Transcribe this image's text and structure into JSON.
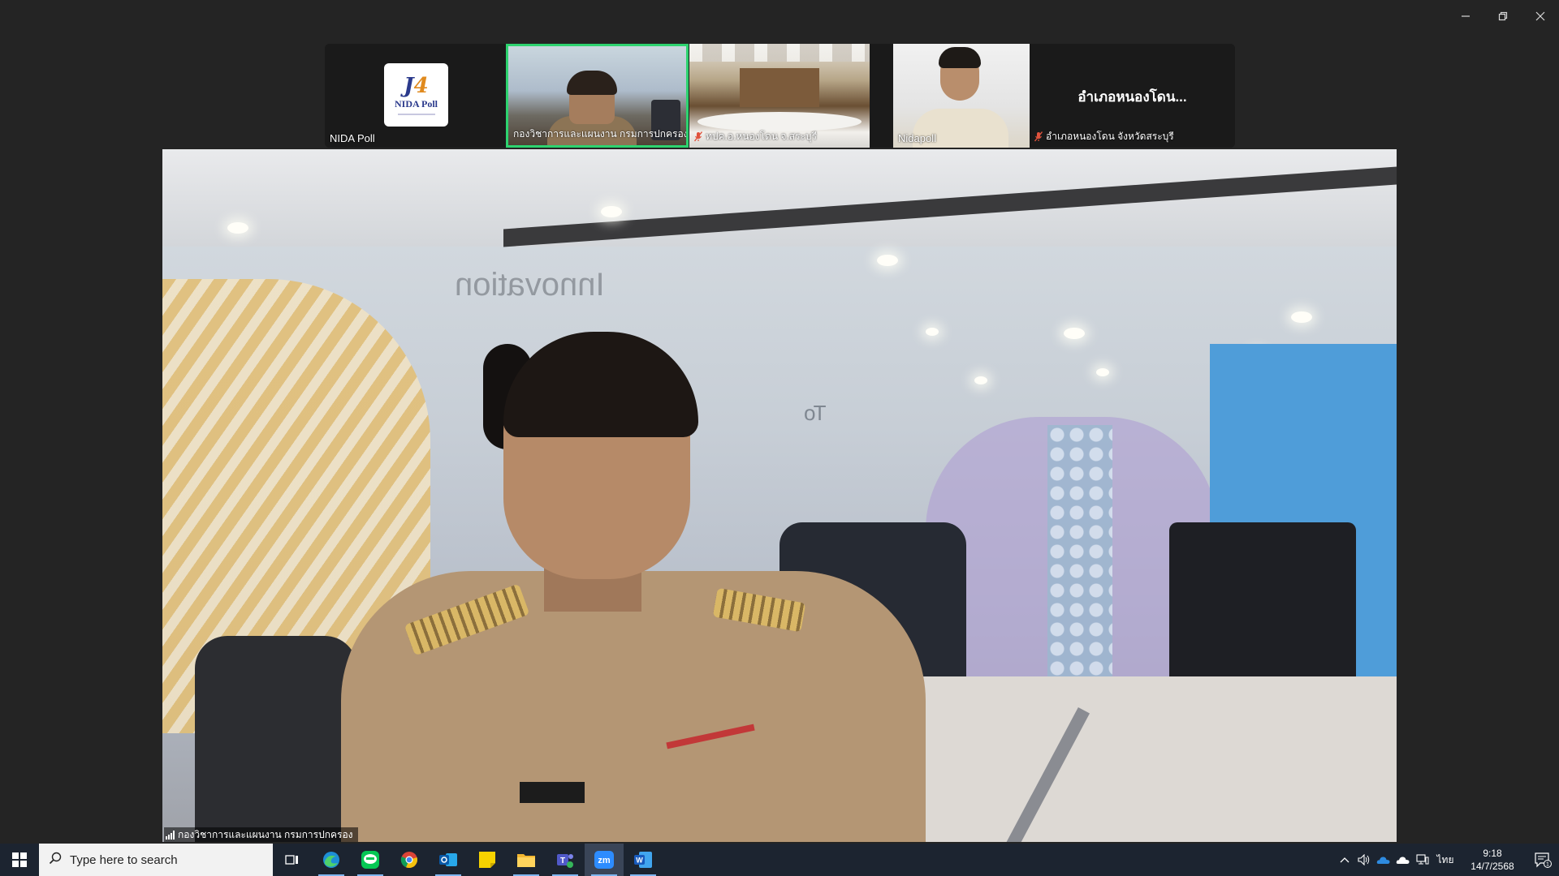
{
  "window": {
    "controls": [
      "minimize-icon",
      "restore-icon",
      "close-icon"
    ]
  },
  "participants": {
    "nida_poll": {
      "name": "NIDA Poll",
      "logo_text": "NIDA Poll"
    },
    "division": {
      "name": "กองวิชาการและแผนงาน กรมการปกครอง",
      "active_speaker": true
    },
    "district_office": {
      "name": "ทปค.อ.หนองโดน จ.สระบุรี",
      "muted": true
    },
    "nidapoll": {
      "name": "Nidapoll"
    },
    "district": {
      "title": "อำเภอหนองโดน...",
      "name": "อำเภอหนองโดน จังหวัดสระบุรี",
      "muted": true
    }
  },
  "main_video": {
    "speaker_label": "กองวิชาการและแผนงาน กรมการปกครอง",
    "glass_text_1": "Innovation",
    "glass_text_2": "To"
  },
  "taskbar": {
    "search_placeholder": "Type here to search",
    "apps": [
      "task-view-icon",
      "edge-icon",
      "line-icon",
      "chrome-icon",
      "outlook-icon",
      "sticky-notes-icon",
      "file-explorer-icon",
      "teams-icon",
      "zoom-icon",
      "word-icon"
    ],
    "active_app": "zoom-icon",
    "tray": {
      "language": "ไทย",
      "time": "9:18",
      "date": "14/7/2568",
      "notifications": "1"
    }
  },
  "colors": {
    "active_speaker_border": "#2dd36f",
    "muted_icon": "#e0533d",
    "background": "#242424",
    "taskbar": "#1c2430"
  }
}
